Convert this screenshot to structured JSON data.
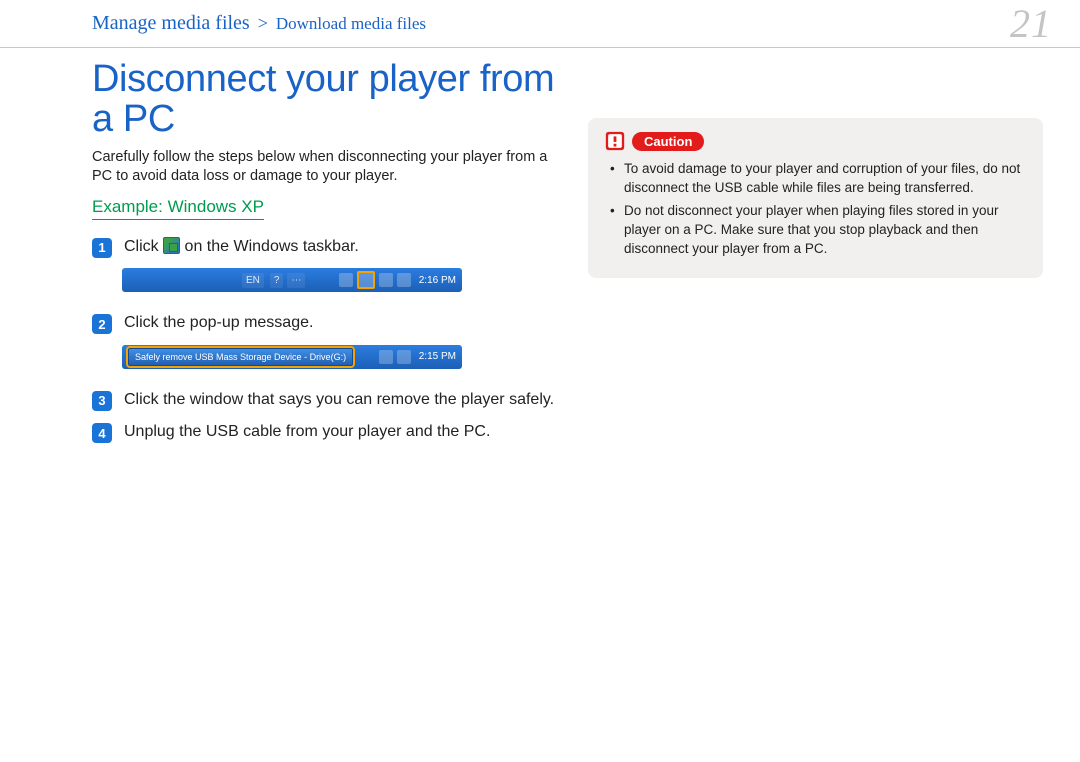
{
  "header": {
    "breadcrumb_main": "Manage media files",
    "breadcrumb_sep": ">",
    "breadcrumb_sub": "Download media files",
    "page_number": "21"
  },
  "title": "Disconnect your player from a PC",
  "intro": "Carefully follow the steps below when disconnecting your player from a PC to avoid data loss or damage to your player.",
  "example_label": "Example: Windows XP",
  "steps": {
    "s1_pre": "Click ",
    "s1_post": " on the Windows taskbar.",
    "s2": "Click the pop-up message.",
    "s3": "Click the window that says you can remove the player safely.",
    "s4": "Unplug the USB cable from your player and the PC."
  },
  "taskbar1": {
    "lang": "EN",
    "time": "2:16 PM"
  },
  "taskbar2": {
    "popup": "Safely remove USB Mass Storage Device - Drive(G:)",
    "time": "2:15 PM"
  },
  "caution": {
    "label": "Caution",
    "items": [
      "To avoid damage to your player and corruption of your files, do not disconnect the USB cable while files are being transferred.",
      "Do not disconnect your player when playing files stored in your player on a PC. Make sure that you stop playback and then disconnect your player from a PC."
    ]
  }
}
